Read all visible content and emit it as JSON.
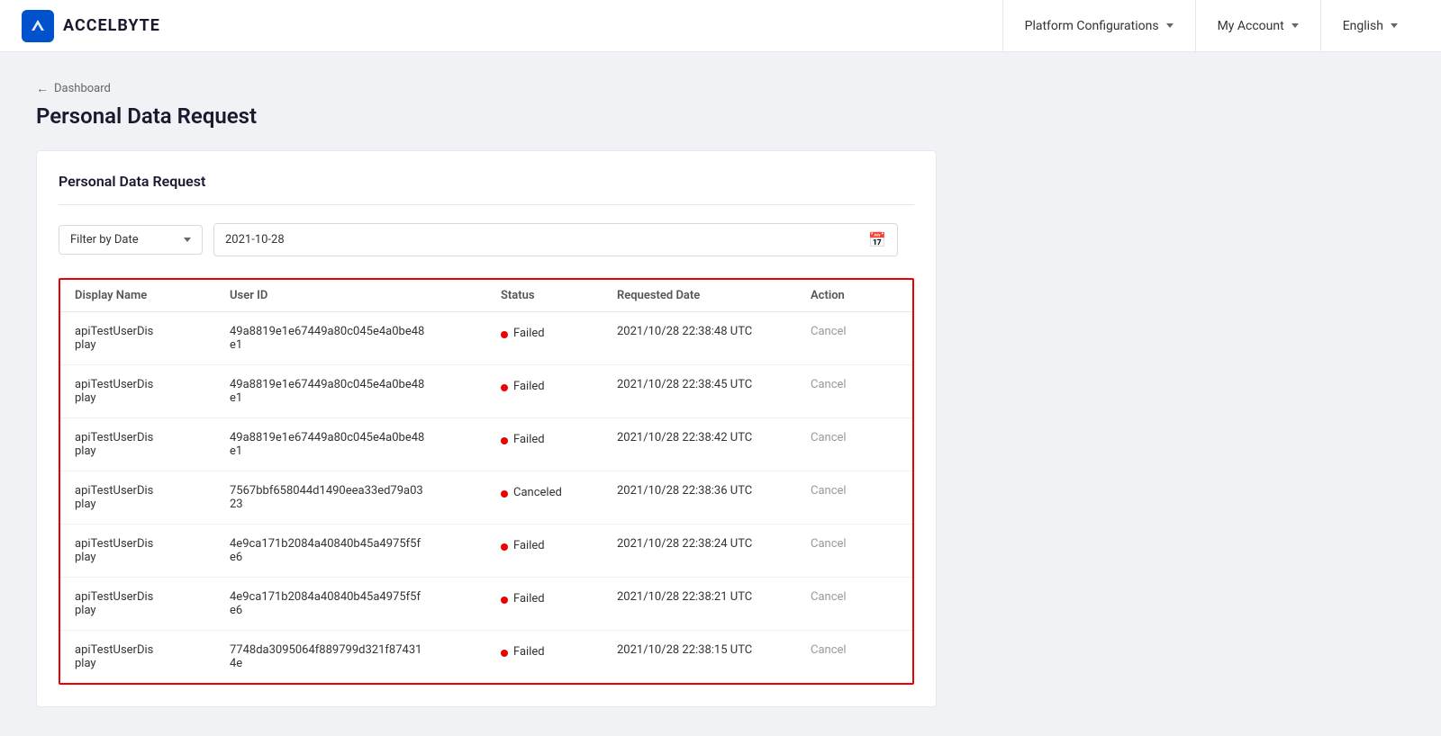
{
  "header": {
    "logo_text": "ACCELBYTE",
    "logo_abbr": "AB",
    "nav": [
      {
        "label": "Platform Configurations",
        "has_dropdown": true
      },
      {
        "label": "My Account",
        "has_dropdown": true
      },
      {
        "label": "English",
        "has_dropdown": true
      }
    ]
  },
  "breadcrumb": {
    "arrow": "←",
    "link_label": "Dashboard"
  },
  "page_title": "Personal Data Request",
  "card": {
    "title": "Personal Data Request",
    "filter": {
      "label": "Filter by Date",
      "date_value": "2021-10-28"
    },
    "table": {
      "columns": [
        "Display Name",
        "User ID",
        "Status",
        "Requested Date",
        "Action"
      ],
      "rows": [
        {
          "display_name": "apiTestUserDisplay",
          "user_id": "49a8819e1e67449a80c045e4a0be48e1",
          "status": "Failed",
          "status_type": "failed",
          "requested_date": "2021/10/28 22:38:48 UTC",
          "action": "Cancel"
        },
        {
          "display_name": "apiTestUserDisplay",
          "user_id": "49a8819e1e67449a80c045e4a0be48e1",
          "status": "Failed",
          "status_type": "failed",
          "requested_date": "2021/10/28 22:38:45 UTC",
          "action": "Cancel"
        },
        {
          "display_name": "apiTestUserDisplay",
          "user_id": "49a8819e1e67449a80c045e4a0be48e1",
          "status": "Failed",
          "status_type": "failed",
          "requested_date": "2021/10/28 22:38:42 UTC",
          "action": "Cancel"
        },
        {
          "display_name": "apiTestUserDisplay",
          "user_id": "7567bbf658044d1490eea33ed79a0323",
          "status": "Canceled",
          "status_type": "canceled",
          "requested_date": "2021/10/28 22:38:36 UTC",
          "action": "Cancel"
        },
        {
          "display_name": "apiTestUserDisplay",
          "user_id": "4e9ca171b2084a40840b45a4975f5fe6",
          "status": "Failed",
          "status_type": "failed",
          "requested_date": "2021/10/28 22:38:24 UTC",
          "action": "Cancel"
        },
        {
          "display_name": "apiTestUserDisplay",
          "user_id": "4e9ca171b2084a40840b45a4975f5fe6",
          "status": "Failed",
          "status_type": "failed",
          "requested_date": "2021/10/28 22:38:21 UTC",
          "action": "Cancel"
        },
        {
          "display_name": "apiTestUserDisplay",
          "user_id": "7748da3095064f889799d321f874314e",
          "status": "Failed",
          "status_type": "failed",
          "requested_date": "2021/10/28 22:38:15 UTC",
          "action": "Cancel"
        }
      ]
    }
  }
}
